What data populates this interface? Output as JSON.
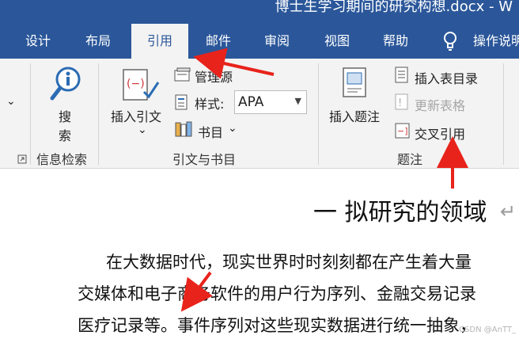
{
  "window": {
    "title": "博士生学习期间的研究构想.docx - W"
  },
  "tabs": [
    {
      "label": "设计"
    },
    {
      "label": "布局"
    },
    {
      "label": "引用"
    },
    {
      "label": "邮件"
    },
    {
      "label": "审阅"
    },
    {
      "label": "视图"
    },
    {
      "label": "帮助"
    },
    {
      "label": "操作说明"
    }
  ],
  "ribbon": {
    "research": {
      "btn_top": "搜",
      "btn_bottom": "索",
      "group": "信息检索"
    },
    "citations": {
      "insert_citation": "插入引文",
      "manage_sources": "管理源",
      "style_label": "样式:",
      "style_value": "APA",
      "bibliography": "书目",
      "group": "引文与书目"
    },
    "captions": {
      "insert_caption": "插入题注",
      "insert_table_of_figures": "插入表目录",
      "update_table": "更新表格",
      "cross_reference": "交叉引用",
      "group": "题注"
    }
  },
  "document": {
    "heading": "一  拟研究的领域",
    "lines": [
      "在大数据时代，现实世界时时刻刻都在产生着大量",
      "交媒体和电子商务软件的用户行为序列、金融交易记录",
      "医疗记录等。事件序列对这些现实数据进行统一抽象，"
    ]
  },
  "watermark": "CSDN @AnTT_",
  "colors": {
    "ribbon_blue": "#2b579a",
    "ribbon_bg": "#f3f3f3",
    "arrow_red": "#e8231b"
  }
}
